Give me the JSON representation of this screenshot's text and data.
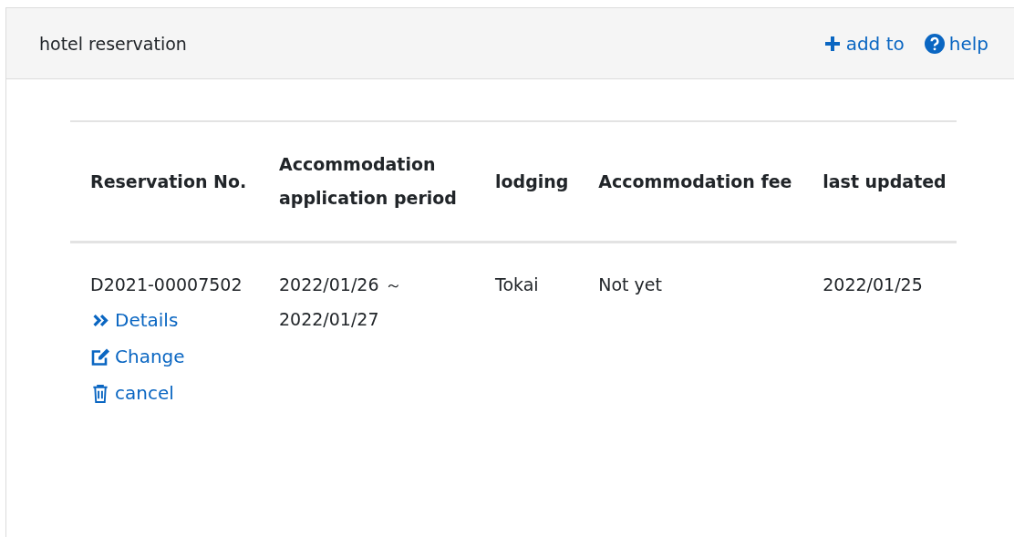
{
  "panel": {
    "title": "hotel reservation",
    "actions": [
      {
        "kind": "add",
        "label": "add to"
      },
      {
        "kind": "help",
        "label": "help"
      }
    ]
  },
  "table": {
    "columns": [
      "Reservation No.",
      "Accommodation application period",
      "lodging",
      "Accommodation fee",
      "last updated"
    ],
    "rows": [
      {
        "cells": [
          "D2021-00007502",
          "2022/01/26 ～ 2022/01/27",
          "Tokai",
          "Not yet",
          "2022/01/25"
        ],
        "links": [
          {
            "kind": "details",
            "label": "Details"
          },
          {
            "kind": "change",
            "label": "Change"
          },
          {
            "kind": "cancel",
            "label": "cancel"
          }
        ]
      }
    ]
  }
}
